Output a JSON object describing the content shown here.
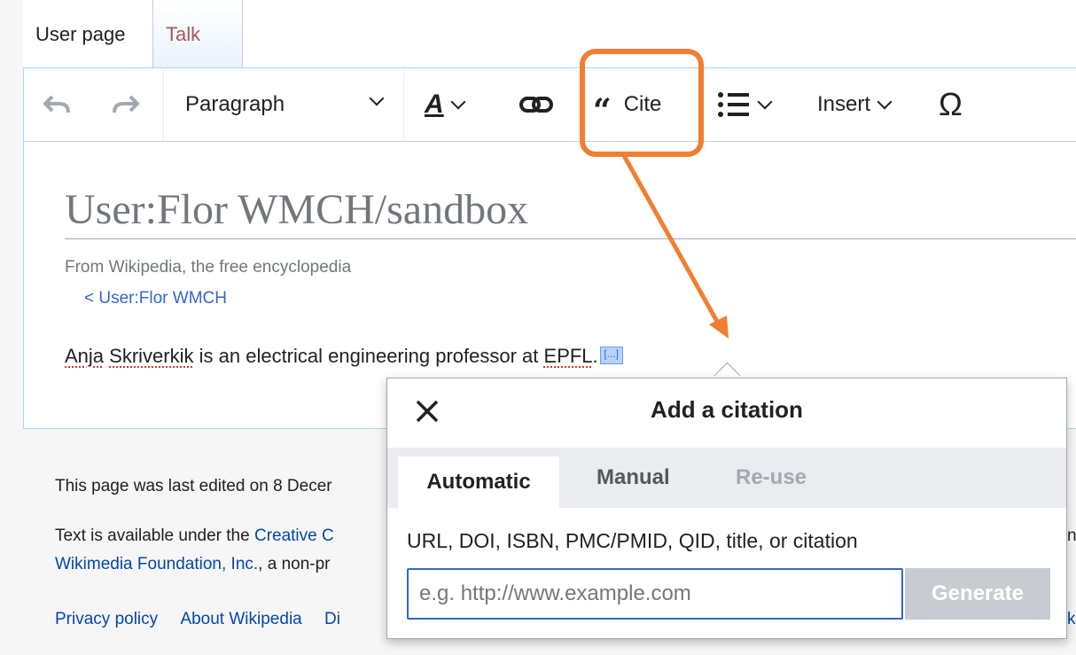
{
  "tabs": {
    "user_page": "User page",
    "talk": "Talk"
  },
  "toolbar": {
    "paragraph": "Paragraph",
    "cite": "Cite",
    "insert": "Insert",
    "special_char": "Ω"
  },
  "page": {
    "title": "User:Flor WMCH/sandbox",
    "from": "From Wikipedia, the free encyclopedia",
    "back_link": "< User:Flor WMCH",
    "para_name1": "Anja",
    "para_name2": "Skriverkik",
    "para_mid": " is an electrical engineering professor at ",
    "para_org": "EPFL",
    "para_end": ".",
    "cite_marker": "[...]"
  },
  "footer": {
    "edited": "This page was last edited on 8 Decer",
    "text_prefix": "Text is available under the ",
    "text_link": "Creative C",
    "wmf": "Wikimedia Foundation, Inc.",
    "wmf_suffix": ", a non-pr",
    "privacy": "Privacy policy",
    "about": "About Wikipedia",
    "di": "Di",
    "right_n": "n",
    "right_k": "k"
  },
  "dialog": {
    "title": "Add a citation",
    "tabs": [
      "Automatic",
      "Manual",
      "Re-use"
    ],
    "label": "URL, DOI, ISBN, PMC/PMID, QID, title, or citation",
    "input_placeholder": "e.g. http://www.example.com",
    "input_value": "",
    "generate": "Generate"
  },
  "colors": {
    "highlight": "#f07f32",
    "link": "#0645ad",
    "accent": "#3366cc"
  }
}
